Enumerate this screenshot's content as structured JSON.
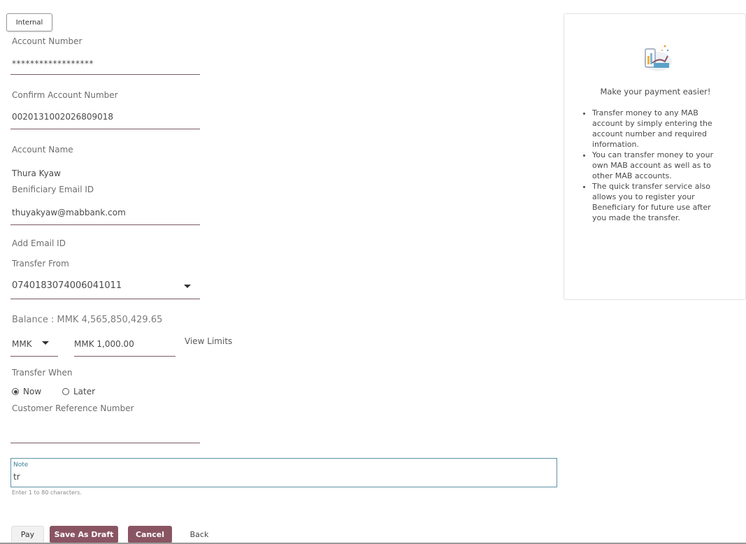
{
  "internal_tab": "Internal",
  "form": {
    "account_number_label": "Account Number",
    "account_number_value": "******************",
    "confirm_account_label": "Confirm Account Number",
    "confirm_account_value": "0020131002026809018",
    "account_name_label": "Account Name",
    "account_name_value": "Thura Kyaw",
    "email_label": "Benificiary Email ID",
    "email_value": "thuyakyaw@mabbank.com",
    "add_email_label": "Add Email ID",
    "transfer_from_label": "Transfer From",
    "transfer_from_value": "0740183074006041011",
    "balance_text": "Balance : MMK 4,565,850,429.65",
    "currency_value": "MMK",
    "amount_value": "MMK 1,000.00",
    "view_limits_label": "View Limits",
    "transfer_when_label": "Transfer When",
    "transfer_when_options": [
      "Now",
      "Later"
    ],
    "transfer_when_selected": "Now",
    "customer_ref_label": "Customer Reference Number",
    "customer_ref_value": "",
    "note_label": "Note",
    "note_value": "tr",
    "note_hint": "Enter 1 to 80 characters."
  },
  "buttons": {
    "pay": "Pay",
    "save_draft": "Save As Draft",
    "cancel": "Cancel",
    "back": "Back"
  },
  "info_panel": {
    "title": "Make your payment easier!",
    "bullets": [
      "Transfer money to any MAB account by simply entering the account number and required information.",
      "You can transfer money to your own MAB account as well as to other MAB accounts.",
      "The quick transfer service also allows you to register your Beneficiary for future use after you made the transfer."
    ]
  },
  "colors": {
    "accent": "#8a5563",
    "underline": "#7a5a63",
    "note_border": "#5b93a6"
  }
}
